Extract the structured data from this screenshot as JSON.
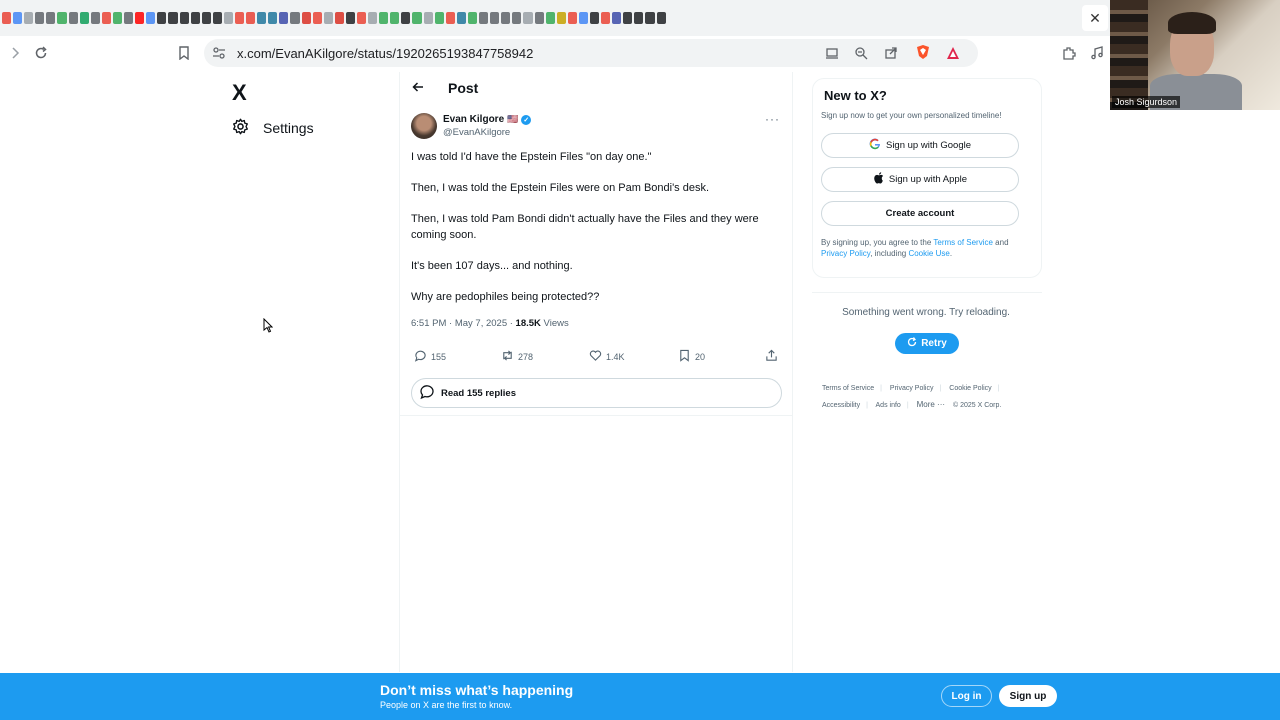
{
  "browser": {
    "url": "x.com/EvanAKilgore/status/1920265193847758942",
    "close_glyph": "✕",
    "tab_colors": [
      "#e94235",
      "#4285f4",
      "#9aa0a6",
      "#5f6368",
      "#5f6368",
      "#34a853",
      "#5f6368",
      "#0f9d58",
      "#5f6368",
      "#ea4335",
      "#34a853",
      "#5f6368",
      "#ff0000",
      "#4285f4",
      "#202124",
      "#202124",
      "#202124",
      "#202124",
      "#202124",
      "#202124",
      "#9aa0a6",
      "#ea4335",
      "#e94235",
      "#21759b",
      "#21759b",
      "#3c4aa8",
      "#5f6368",
      "#d93025",
      "#ea4335",
      "#9aa0a6",
      "#d93025",
      "#202124",
      "#ea4335",
      "#9aa0a6",
      "#34a853",
      "#34a853",
      "#202124",
      "#34a853",
      "#9aa0a6",
      "#34a853",
      "#ea4335",
      "#21759b",
      "#34a853",
      "#5f6368",
      "#5f6368",
      "#5f6368",
      "#5f6368",
      "#9aa0a6",
      "#5f6368",
      "#34a853",
      "#c5a100",
      "#ea4335",
      "#4285f4",
      "#202124",
      "#ea4335",
      "#3c4aa8",
      "#202124",
      "#202124",
      "#202124",
      "#202124"
    ]
  },
  "webcam": {
    "name": "Josh Sigurdson"
  },
  "left_nav": {
    "logo": "X",
    "settings_label": "Settings"
  },
  "post": {
    "header_title": "Post",
    "author_name": "Evan Kilgore",
    "author_flag": "🇺🇸",
    "verified_glyph": "✓",
    "author_handle": "@EvanAKilgore",
    "more_glyph": "···",
    "paragraphs": [
      "I was told I'd have the Epstein Files \"on day one.\"",
      "Then, I was told the Epstein Files were on Pam Bondi's desk.",
      "Then, I was told Pam Bondi didn't actually have the Files and they were coming soon.",
      "It's been 107 days... and nothing.",
      "Why are pedophiles being protected??"
    ],
    "timestamp": "6:51 PM · May 7, 2025 · ",
    "views_count": "18.5K",
    "views_label": " Views",
    "replies": "155",
    "reposts": "278",
    "likes": "1.4K",
    "bookmarks": "20",
    "read_replies_label": "Read 155 replies"
  },
  "signup_box": {
    "title": "New to X?",
    "subtitle": "Sign up now to get your own personalized timeline!",
    "google_label": "Sign up with Google",
    "apple_label": "Sign up with Apple",
    "create_label": "Create account",
    "terms_prefix": "By signing up, you agree to the ",
    "terms_link": "Terms of Service",
    "terms_and": " and ",
    "privacy_link": "Privacy Policy",
    "terms_including": ", including ",
    "cookie_link": "Cookie Use",
    "terms_end": "."
  },
  "error_box": {
    "message": "Something went wrong. Try reloading.",
    "retry_label": "Retry"
  },
  "footer": {
    "terms": "Terms of Service",
    "privacy": "Privacy Policy",
    "cookie": "Cookie Policy",
    "accessibility": "Accessibility",
    "ads_info": "Ads info",
    "more": "More ···",
    "copyright": "© 2025 X Corp."
  },
  "bottom_bar": {
    "title": "Don’t miss what’s happening",
    "subtitle": "People on X are the first to know.",
    "login_label": "Log in",
    "signup_label": "Sign up"
  }
}
